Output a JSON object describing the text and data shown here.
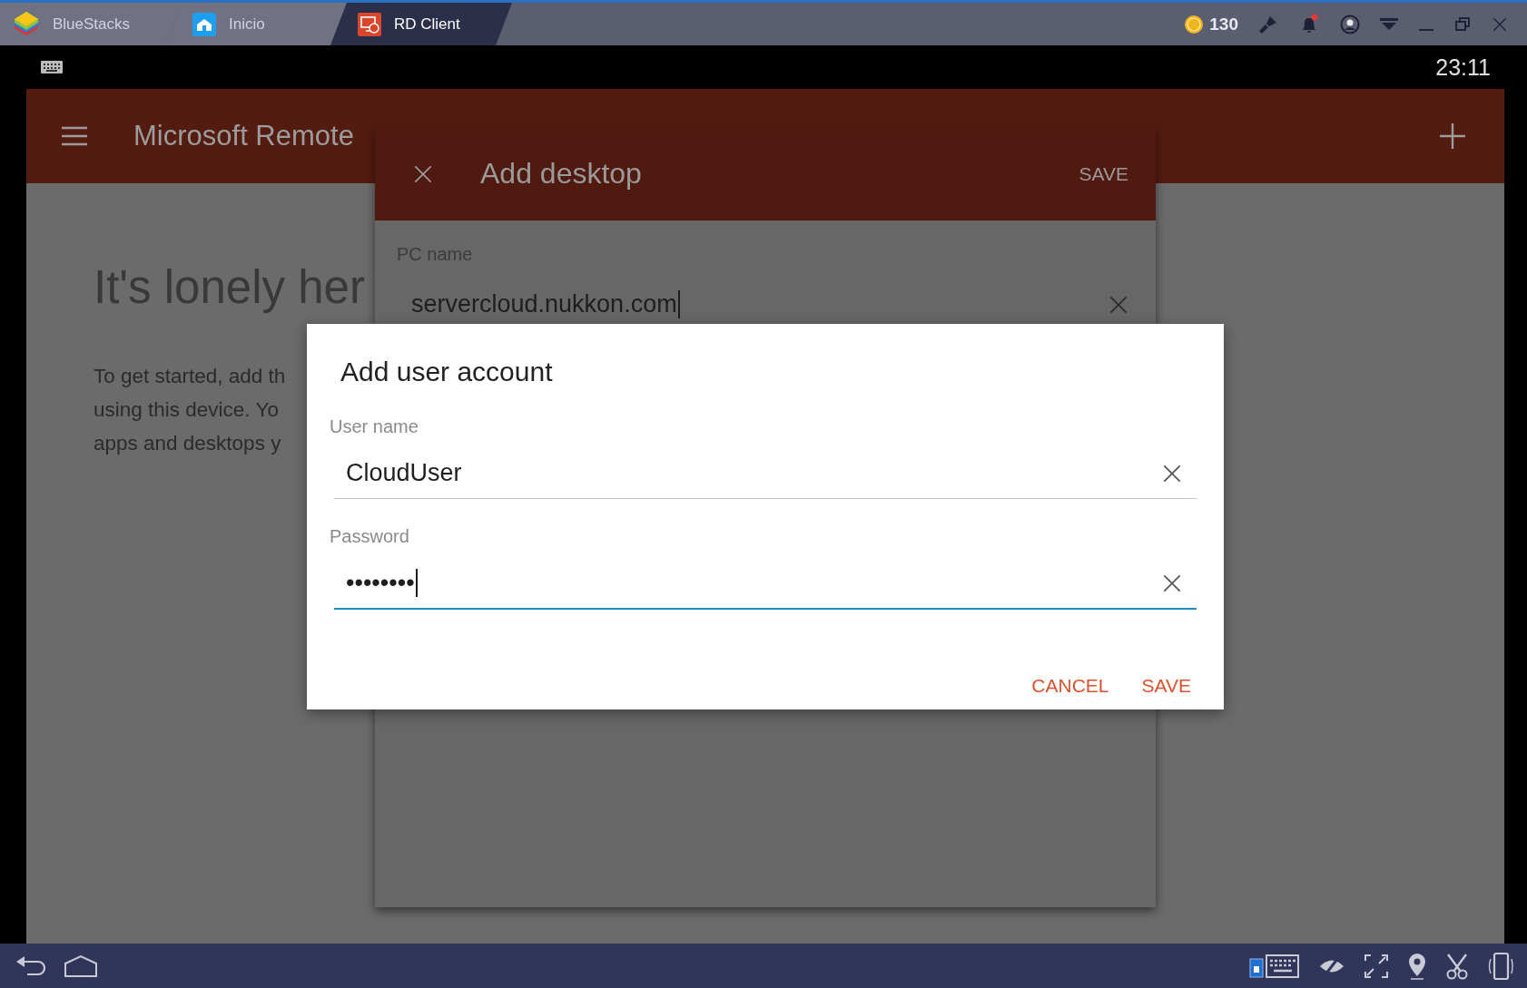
{
  "title_bar": {
    "tabs": [
      {
        "label": "BlueStacks",
        "kind": "brand",
        "selected": false
      },
      {
        "label": "Inicio",
        "kind": "home",
        "selected": false
      },
      {
        "label": "RD Client",
        "kind": "app",
        "selected": true
      }
    ],
    "coins": "130"
  },
  "status_bar": {
    "time": "23:11"
  },
  "app_bar": {
    "title": "Microsoft Remote"
  },
  "empty_state": {
    "heading": "It's lonely her",
    "lines": [
      "To get started, add th",
      "using this device. Yo",
      "apps and desktops y"
    ]
  },
  "add_desktop": {
    "title": "Add desktop",
    "action": "SAVE",
    "pc_name": {
      "label": "PC name",
      "value": "servercloud.nukkon.com"
    }
  },
  "dialog": {
    "title": "Add user account",
    "fields": [
      {
        "label": "User name",
        "value": "CloudUser",
        "focused": false
      },
      {
        "label": "Password",
        "value": "••••••••",
        "focused": true
      }
    ],
    "buttons": [
      "CANCEL",
      "SAVE"
    ]
  }
}
